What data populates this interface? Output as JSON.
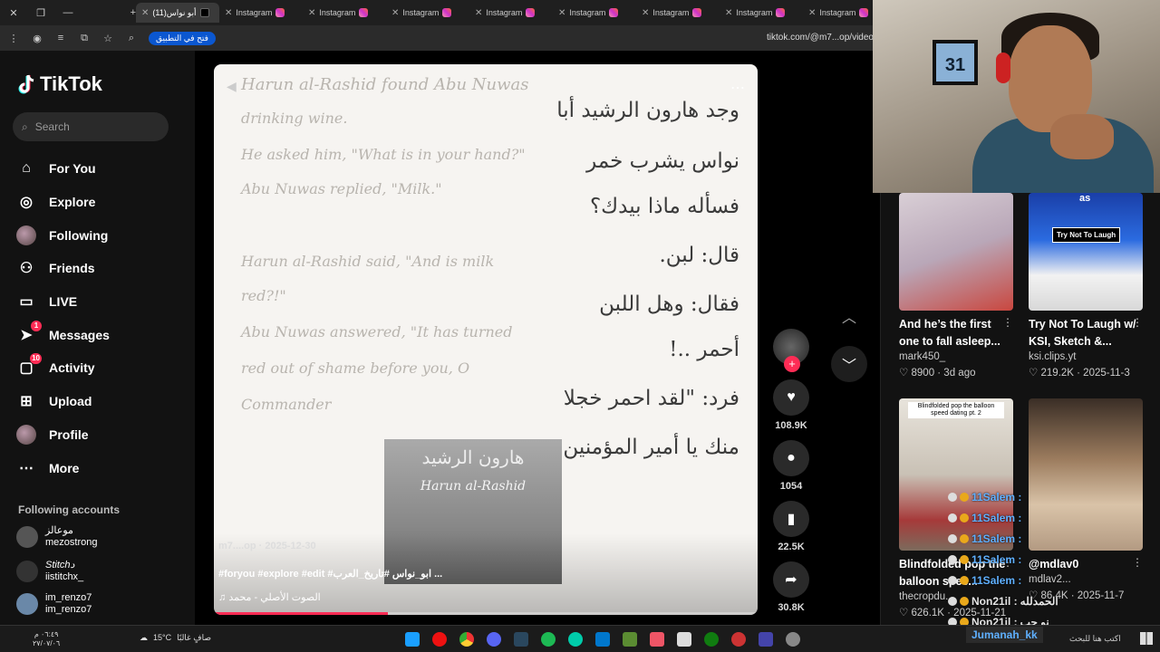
{
  "browser": {
    "tabs": [
      {
        "label": "(11)أبو نواس",
        "active": true
      },
      {
        "label": "Instagram"
      },
      {
        "label": "Instagram"
      },
      {
        "label": "Instagram"
      },
      {
        "label": "Instagram"
      },
      {
        "label": "Instagram"
      },
      {
        "label": "Instagram"
      },
      {
        "label": "Instagram"
      },
      {
        "label": "Instagram"
      }
    ],
    "open_app_label": "فتح في التطبيق",
    "url": "tiktok.com/@m7...op/video/"
  },
  "sidebar": {
    "logo_text": "TikTok",
    "search_placeholder": "Search",
    "nav": [
      {
        "label": "For You",
        "icon": "home-icon"
      },
      {
        "label": "Explore",
        "icon": "compass-icon"
      },
      {
        "label": "Following",
        "icon": "avatar-icon"
      },
      {
        "label": "Friends",
        "icon": "friends-icon"
      },
      {
        "label": "LIVE",
        "icon": "live-icon"
      },
      {
        "label": "Messages",
        "icon": "send-icon",
        "badge": "1"
      },
      {
        "label": "Activity",
        "icon": "inbox-icon",
        "badge": "10"
      },
      {
        "label": "Upload",
        "icon": "upload-icon"
      },
      {
        "label": "Profile",
        "icon": "profile-avatar-icon"
      },
      {
        "label": "More",
        "icon": "more-icon"
      }
    ],
    "following_title": "Following accounts",
    "following": [
      {
        "name": "موعالز",
        "handle": "mezostrong"
      },
      {
        "name": "Stitchد",
        "handle": "iistitchx_"
      },
      {
        "name": "im_renzo7",
        "handle": "im_renzo7"
      }
    ]
  },
  "video": {
    "english_lines": [
      "Harun al-Rashid found Abu Nuwas",
      "drinking wine.",
      "He asked him, \"What is in your hand?\"",
      "Abu Nuwas replied, \"Milk.\"",
      "Harun al-Rashid said, \"And is milk",
      "red?!\"",
      "Abu Nuwas answered, \"It has turned",
      "red out of shame before you, O",
      "Commander"
    ],
    "arabic_lines": [
      "وجد هارون الرشيد أبا",
      "نواس يشرب خمر",
      "فسأله ماذا بيدك؟",
      "قال: لبن.",
      "فقال: وهل اللبن",
      "أحمر ..!",
      "فرد: \"لقد احمر خجلا",
      "منك يا أمير المؤمنين"
    ],
    "photo_title": "هارون الرشيد",
    "photo_subtitle": "Harun al-Rashid",
    "meta": "m7....op · 2025-12-30",
    "caption": "#foryou #explore #edit #ابو_نواس #تاريخ_العرب ...",
    "sound": "♫  الصوت الأصلي - محمد",
    "progress": 0.32
  },
  "actions": {
    "likes": "108.9K",
    "comments": "1054",
    "saves": "22.5K",
    "shares": "30.8K"
  },
  "recommended": [
    {
      "title": "And he’s the first one to fall asleep...",
      "author": "mark450_",
      "stats": "♡ 8900 · 3d ago"
    },
    {
      "title": "Try Not To Laugh w/ KSI, Sketch &...",
      "author": "ksi.clips.yt",
      "stats": "♡ 219.2K · 2025-11-3",
      "thumb_label": "Try Not To Laugh",
      "thumb_top": "as"
    },
    {
      "title": "Blindfolded pop the balloon spee...",
      "author": "thecropdu...",
      "stats": "♡ 626.1K · 2025-11-21",
      "thumb_caption": "Blindfolded pop the balloon speed dating pt. 2"
    },
    {
      "title": "@mdlav0",
      "author": "mdlav2...",
      "stats": "♡ 86.4K · 2025-11-7"
    }
  ],
  "webcam": {
    "jersey_number": "31"
  },
  "chat": [
    {
      "user": "11Salem :",
      "msg": ""
    },
    {
      "user": "11Salem :",
      "msg": ""
    },
    {
      "user": "11Salem :",
      "msg": ""
    },
    {
      "user": "11Salem :",
      "msg": ""
    },
    {
      "user": "11Salem :",
      "msg": ""
    },
    {
      "user": "Non21il :",
      "msg": "الحمدلله"
    },
    {
      "user": "Non21il :",
      "msg": "نو حب"
    }
  ],
  "taskbar": {
    "time": "٠٦:٤٩ م",
    "date": "٢٧/٠٧/٠٦",
    "weather_temp": "15°C",
    "weather_text": "صافٍ غالبًا",
    "tray_user": "Jumanah_kk",
    "search_text": "اكتب هنا للبحث"
  }
}
